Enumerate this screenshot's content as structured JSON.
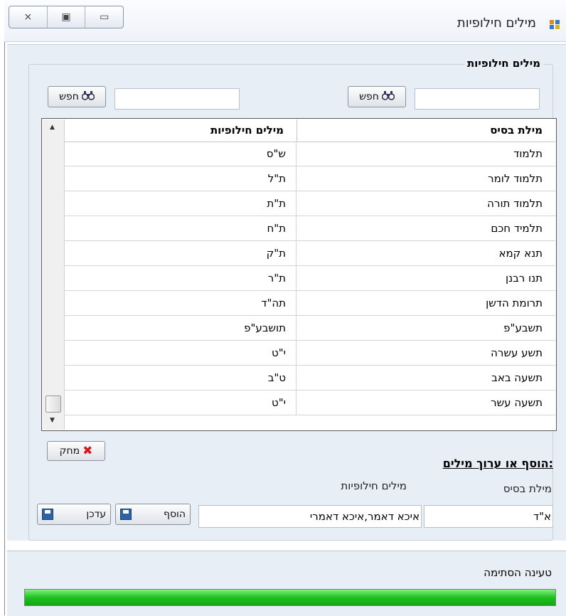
{
  "window": {
    "title": "מילים חילופיות",
    "controls": [
      "close-icon",
      "maximize-icon",
      "minimize-icon"
    ]
  },
  "group": {
    "title": "מילים חילופיות"
  },
  "search": {
    "left_button": "חפש",
    "right_button": "חפש",
    "left_value": "",
    "right_value": ""
  },
  "table": {
    "columns": [
      "מילת בסיס",
      "מילים חילופיות"
    ],
    "rows": [
      {
        "base": "תלמוד",
        "alt": "ש\"ס"
      },
      {
        "base": "תלמוד לומר",
        "alt": "ת\"ל"
      },
      {
        "base": "תלמוד תורה",
        "alt": "ת\"ת"
      },
      {
        "base": "תלמיד חכם",
        "alt": "ת\"ח"
      },
      {
        "base": "תנא קמא",
        "alt": "ת\"ק"
      },
      {
        "base": "תנו רבנן",
        "alt": "ת\"ר"
      },
      {
        "base": "תרומת הדשן",
        "alt": "תה\"ד"
      },
      {
        "base": "תשבע\"פ",
        "alt": "תושבע\"פ"
      },
      {
        "base": "תשע עשרה",
        "alt": "י\"ט"
      },
      {
        "base": "תשעה באב",
        "alt": "ט\"ב"
      },
      {
        "base": "תשעה עשר",
        "alt": "י\"ט"
      }
    ]
  },
  "delete_button": "מחק",
  "add_edit": {
    "title": "הוסף או ערוך מילים:",
    "base_label": "מילת בסיס",
    "alt_label": "מילים חילופיות",
    "base_value": "א\"ד",
    "alt_value": "איכא דאמר,איכא דאמרי",
    "add_button": "הוסף",
    "update_button": "עדכן"
  },
  "status": {
    "label": "טעינה הסתימה",
    "progress": 1.0
  },
  "colors": {
    "panel": "#e8eef6",
    "progress": "#20c020"
  }
}
